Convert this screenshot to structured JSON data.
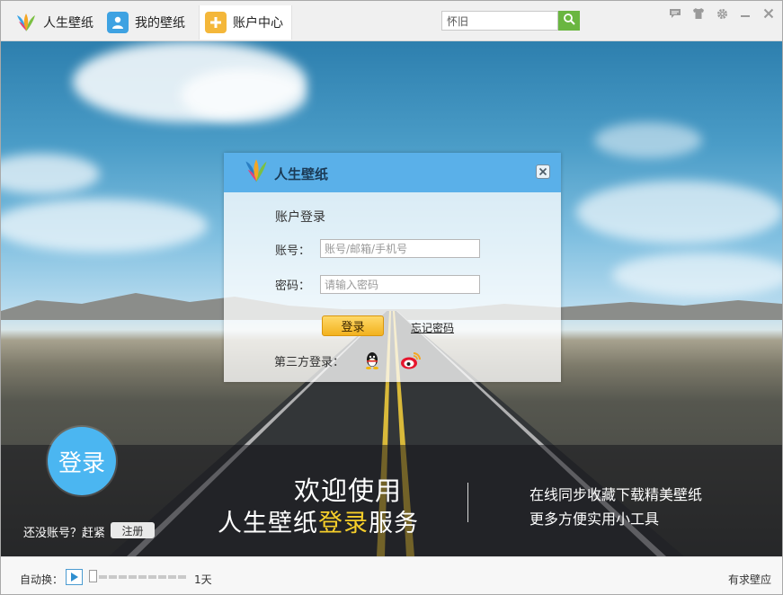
{
  "tabs": [
    {
      "label": "人生壁纸",
      "icon": "app-logo-icon"
    },
    {
      "label": "我的壁纸",
      "icon": "user-icon"
    },
    {
      "label": "账户中心",
      "icon": "plus-icon"
    }
  ],
  "search": {
    "value": "怀旧",
    "button_icon": "search-icon"
  },
  "window_controls": [
    "feedback-icon",
    "skin-shirt-icon",
    "settings-gear-icon",
    "minimize-icon",
    "close-icon"
  ],
  "login_dialog": {
    "brand": "人生壁纸",
    "heading": "账户登录",
    "account_label": "账号：",
    "account_placeholder": "账号/邮箱/手机号",
    "password_label": "密码：",
    "password_placeholder": "请输入密码",
    "login_button": "登录",
    "forgot_link": "忘记密码",
    "third_party_label": "第三方登录：",
    "third_party": [
      "qq-icon",
      "weibo-icon"
    ]
  },
  "banner": {
    "circle_login": "登录",
    "no_account": "还没账号？赶紧",
    "register_button": "注册",
    "welcome_line1": "欢迎使用",
    "welcome_line2_pre": "人生壁纸",
    "welcome_line2_highlight": "登录",
    "welcome_line2_post": "服务",
    "feature_line1": "在线同步收藏下载精美壁纸",
    "feature_line2": "更多方便实用小工具"
  },
  "statusbar": {
    "auto_switch_label": "自动换：",
    "interval_value": "1天",
    "slider_level": 0,
    "request_link": "有求壁应"
  },
  "colors": {
    "accent_blue": "#5ab0e9",
    "login_circle": "#4bb6f1",
    "login_button": "#f2b21e",
    "highlight_yellow": "#f7cf2a",
    "search_green": "#6ab641"
  }
}
